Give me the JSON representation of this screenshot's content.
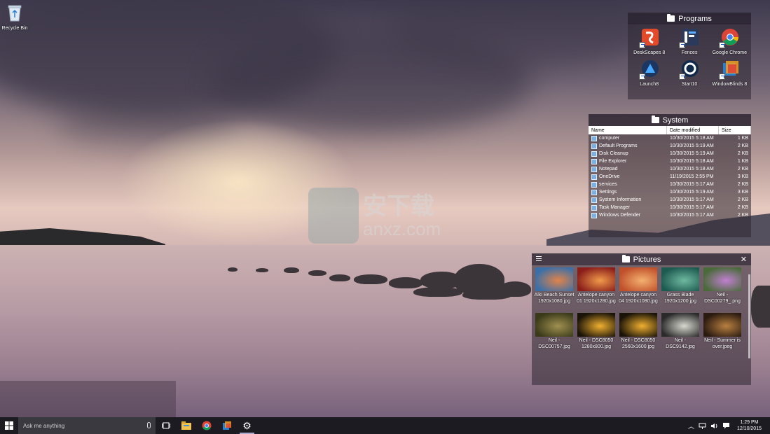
{
  "desktop": {
    "recycle_bin_label": "Recycle Bin"
  },
  "watermark": {
    "line1": "安下载",
    "line2": "anxz.com"
  },
  "programs_fence": {
    "title": "Programs",
    "items": [
      {
        "label": "DeskScapes 8",
        "icon": "deskscapes-icon"
      },
      {
        "label": "Fences",
        "icon": "fences-icon"
      },
      {
        "label": "Google Chrome",
        "icon": "chrome-icon"
      },
      {
        "label": "Launch8",
        "icon": "launch8-icon"
      },
      {
        "label": "Start10",
        "icon": "start10-icon"
      },
      {
        "label": "WindowBlinds 8",
        "icon": "windowblinds-icon"
      }
    ]
  },
  "system_fence": {
    "title": "System",
    "columns": [
      "Name",
      "Date modified",
      "Size"
    ],
    "rows": [
      {
        "name": "computer",
        "date": "10/30/2015 5:18 AM",
        "size": "1 KB"
      },
      {
        "name": "Default Programs",
        "date": "10/30/2015 5:19 AM",
        "size": "2 KB"
      },
      {
        "name": "Disk Cleanup",
        "date": "10/30/2015 5:19 AM",
        "size": "2 KB"
      },
      {
        "name": "File Explorer",
        "date": "10/30/2015 5:18 AM",
        "size": "1 KB"
      },
      {
        "name": "Notepad",
        "date": "10/30/2015 5:18 AM",
        "size": "2 KB"
      },
      {
        "name": "OneDrive",
        "date": "11/19/2015 2:55 PM",
        "size": "3 KB"
      },
      {
        "name": "services",
        "date": "10/30/2015 5:17 AM",
        "size": "2 KB"
      },
      {
        "name": "Settings",
        "date": "10/30/2015 5:19 AM",
        "size": "3 KB"
      },
      {
        "name": "System Information",
        "date": "10/30/2015 5:17 AM",
        "size": "2 KB"
      },
      {
        "name": "Task Manager",
        "date": "10/30/2015 5:17 AM",
        "size": "2 KB"
      },
      {
        "name": "Windows Defender",
        "date": "10/30/2015 5:17 AM",
        "size": "2 KB"
      }
    ]
  },
  "pictures_fence": {
    "title": "Pictures",
    "items": [
      {
        "label": "Alki Beach Sunset 1920x1080.jpg",
        "colors": [
          "#3a6fa8",
          "#e0834a"
        ]
      },
      {
        "label": "Antelope canyon 01 1920x1280.jpg",
        "colors": [
          "#8a1e1a",
          "#f09a4a"
        ]
      },
      {
        "label": "Antelope canyon 04 1920x1080.jpg",
        "colors": [
          "#c0502a",
          "#f4b070"
        ]
      },
      {
        "label": "Grass Blade 1920x1200.jpg",
        "colors": [
          "#1d5a50",
          "#6fb8a0"
        ]
      },
      {
        "label": "Neil - DSC00279_.png",
        "colors": [
          "#4a6a3a",
          "#c080d0"
        ]
      },
      {
        "label": "Neil - DSC00757.jpg",
        "colors": [
          "#3a3a1a",
          "#a09050"
        ]
      },
      {
        "label": "Neil - DSC8050 1280x800.jpg",
        "colors": [
          "#1a1408",
          "#f0b030"
        ]
      },
      {
        "label": "Neil - DSC8050 2560x1600.jpg",
        "colors": [
          "#1a1408",
          "#f0b030"
        ]
      },
      {
        "label": "Neil - DSC9142.jpg",
        "colors": [
          "#2a2a2a",
          "#d8d8d0"
        ]
      },
      {
        "label": "Neil - Summer is over.jpeg",
        "colors": [
          "#2a1a10",
          "#b88040"
        ]
      }
    ]
  },
  "taskbar": {
    "search_placeholder": "Ask me anything",
    "time": "1:29 PM",
    "date": "12/10/2015"
  }
}
